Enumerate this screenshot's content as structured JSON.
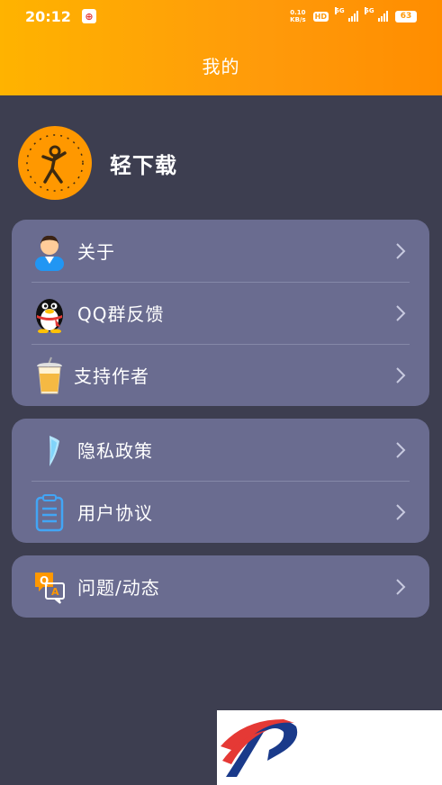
{
  "status_bar": {
    "time": "20:12",
    "speed_value": "0.10",
    "speed_unit": "KB/s",
    "hd_label": "HD",
    "sim1_label": "5G",
    "sim2_label": "5G",
    "battery": "63"
  },
  "header": {
    "title": "我的"
  },
  "profile": {
    "name": "轻下载"
  },
  "cards": [
    {
      "items": [
        {
          "label": "关于",
          "icon": "user-icon"
        },
        {
          "label": "QQ群反馈",
          "icon": "qq-penguin-icon"
        },
        {
          "label": "支持作者",
          "icon": "drink-cup-icon"
        }
      ]
    },
    {
      "items": [
        {
          "label": "隐私政策",
          "icon": "privacy-shield-icon"
        },
        {
          "label": "用户协议",
          "icon": "agreement-clipboard-icon"
        }
      ]
    },
    {
      "items": [
        {
          "label": "问题/动态",
          "icon": "qa-chat-icon"
        }
      ]
    }
  ],
  "colors": {
    "header_gradient_start": "#ffb300",
    "header_gradient_end": "#ff8d00",
    "background": "#3d3e50",
    "card": "#6a6c90"
  }
}
